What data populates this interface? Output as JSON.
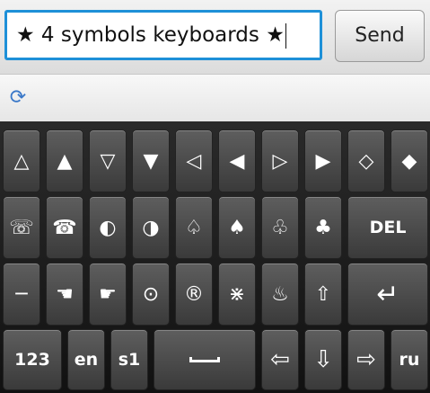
{
  "input": {
    "value": "★ 4 symbols keyboards ★"
  },
  "send_label": "Send",
  "icons": {
    "refresh": "refresh-icon"
  },
  "keyboard": {
    "row1": [
      "△",
      "▲",
      "▽",
      "▼",
      "◁",
      "◀",
      "▷",
      "▶",
      "◇",
      "◆"
    ],
    "row2": [
      "☏",
      "☎",
      "◐",
      "◑",
      "♤",
      "♠",
      "♧",
      "♣"
    ],
    "row2_del": "DEL",
    "row3": [
      "─",
      "☚",
      "☛",
      "⊙",
      "®",
      "⋇",
      "♨",
      "⇧"
    ],
    "row3_enter": "↵",
    "row4": {
      "k123": "123",
      "en": "en",
      "s1": "s1",
      "arrows": [
        "⇦",
        "⇩",
        "⇨"
      ],
      "ru": "ru"
    }
  }
}
